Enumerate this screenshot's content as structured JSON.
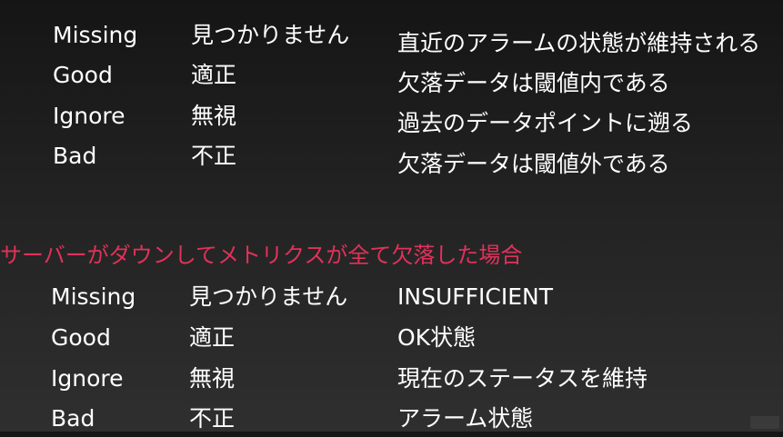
{
  "table1": {
    "rows": [
      {
        "option": "Missing",
        "label": "見つかりません",
        "desc": "直近のアラームの状態が維持される"
      },
      {
        "option": "Good",
        "label": "適正",
        "desc": "欠落データは閾値内である"
      },
      {
        "option": "Ignore",
        "label": "無視",
        "desc": "過去のデータポイントに遡る"
      },
      {
        "option": "Bad",
        "label": "不正",
        "desc": "欠落データは閾値外である"
      }
    ]
  },
  "section_heading": "サーバーがダウンしてメトリクスが全て欠落した場合",
  "table2": {
    "rows": [
      {
        "option": "Missing",
        "label": "見つかりません",
        "state": "INSUFFICIENT"
      },
      {
        "option": "Good",
        "label": "適正",
        "state": "OK状態"
      },
      {
        "option": "Ignore",
        "label": "無視",
        "state": "現在のステータスを維持"
      },
      {
        "option": "Bad",
        "label": "不正",
        "state": "アラーム状態"
      }
    ]
  },
  "colors": {
    "heading": "#e0325a",
    "text": "#ffffff"
  }
}
